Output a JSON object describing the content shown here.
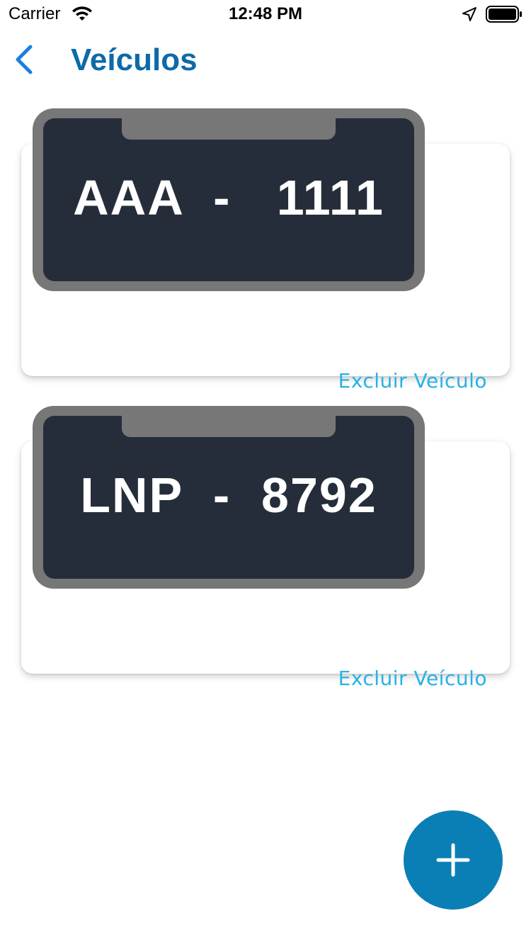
{
  "status_bar": {
    "carrier": "Carrier",
    "time": "12:48 PM"
  },
  "header": {
    "title": "Veículos",
    "back_icon": "chevron-left-icon"
  },
  "vehicles": [
    {
      "plate": "AAA  -   1111",
      "delete_label": "Excluir Veículo"
    },
    {
      "plate": "LNP  -  8792",
      "delete_label": "Excluir Veículo"
    }
  ],
  "fab": {
    "icon": "plus-icon"
  },
  "colors": {
    "title": "#0d6aa8",
    "accent_link": "#27b2e6",
    "plate_frame": "#777777",
    "plate_body": "#262d3a",
    "fab": "#0a7fb5",
    "back_chevron": "#1a7fe0"
  }
}
